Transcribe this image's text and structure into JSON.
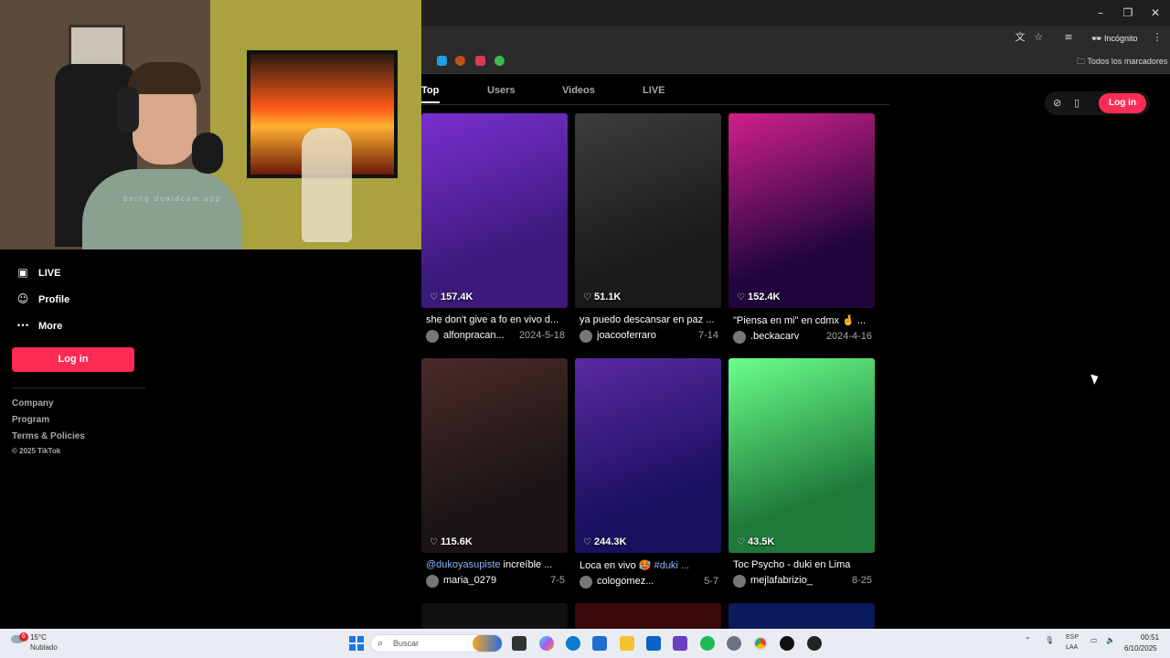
{
  "browser": {
    "incognito_label": "Incógnito",
    "bookmarks_all_label": "Todos los marcadores"
  },
  "webcam": {
    "watermark": "being dcaidcam.app"
  },
  "sidebar": {
    "items": [
      {
        "label": "LIVE",
        "icon": "live-icon"
      },
      {
        "label": "Profile",
        "icon": "person-icon"
      },
      {
        "label": "More",
        "icon": "more-icon"
      }
    ],
    "login_label": "Log in",
    "footer": {
      "company": "Company",
      "program": "Program",
      "terms": "Terms & Policies",
      "copyright": "© 2025 TikTok"
    }
  },
  "tabs": [
    {
      "label": "Top",
      "active": true
    },
    {
      "label": "Users",
      "active": false
    },
    {
      "label": "Videos",
      "active": false
    },
    {
      "label": "LIVE",
      "active": false
    }
  ],
  "header": {
    "login_label": "Log in"
  },
  "videos": [
    {
      "likes": "157.4K",
      "desc": "she don't give a fo en vivo d...",
      "desc_tag": "",
      "user": "alfonpracan...",
      "date": "2024-5-18",
      "colors": [
        "#3b1a7a",
        "#7a2fd0"
      ]
    },
    {
      "likes": "51.1K",
      "desc": "ya puedo descansar en paz ...",
      "desc_tag": "",
      "user": "joacooferraro",
      "date": "7-14",
      "colors": [
        "#1a1a1a",
        "#3d3d3d"
      ]
    },
    {
      "likes": "152.4K",
      "desc": "\"Piensa en mi\" en cdmx 🤞 ...",
      "desc_tag": "",
      "user": ".beckacarv",
      "date": "2024-4-16",
      "colors": [
        "#20063a",
        "#d0208a"
      ]
    },
    {
      "likes": "115.6K",
      "desc": " increíble ...",
      "desc_tag": "@dukoyasupiste",
      "user": "maria_0279",
      "date": "7-5",
      "colors": [
        "#1a1414",
        "#4a2a2a"
      ]
    },
    {
      "likes": "244.3K",
      "desc": "Loca en vivo 🥵 ",
      "desc_tag": "#duki ...",
      "user": "cologomez...",
      "date": "5-7",
      "colors": [
        "#1a1060",
        "#5a2aa0"
      ]
    },
    {
      "likes": "43.5K",
      "desc": "Toc Psycho - duki en Lima",
      "desc_tag": "",
      "user": "mejlafabrizio_",
      "date": "8-25",
      "colors": [
        "#1f7a3a",
        "#6aff8a"
      ]
    }
  ],
  "taskbar": {
    "weather_badge": "6",
    "weather_temp": "15°C",
    "weather_cond": "Nublado",
    "search_placeholder": "Buscar",
    "lang_top": "ESP",
    "lang_bottom": "LAA",
    "time": "00:51",
    "date": "6/10/2025"
  }
}
